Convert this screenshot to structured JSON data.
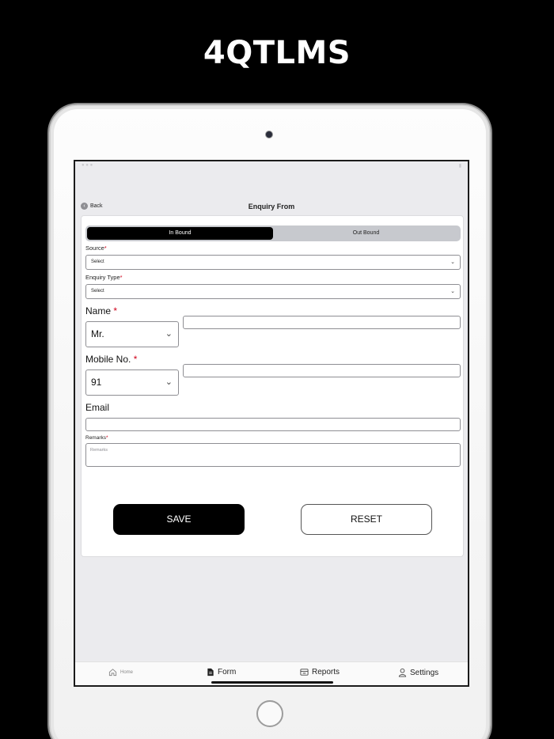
{
  "hero": {
    "title": "4QTLMS"
  },
  "nav": {
    "back_label": "Back",
    "title": "Enquiry From"
  },
  "segment": {
    "in_bound": "In Bound",
    "out_bound": "Out Bound"
  },
  "form": {
    "source": {
      "label": "Source",
      "required": "*",
      "value": "Select"
    },
    "enquiry_type": {
      "label": "Enquiry Type",
      "required": "*",
      "value": "Select"
    },
    "name": {
      "label": "Name",
      "required": "*",
      "title_value": "Mr.",
      "value": ""
    },
    "mobile": {
      "label": "Mobile No.",
      "required": "*",
      "code_value": "91",
      "value": ""
    },
    "email": {
      "label": "Email",
      "value": ""
    },
    "remarks": {
      "label": "Remarks",
      "required": "*",
      "placeholder": "Remarks"
    }
  },
  "buttons": {
    "save": "SAVE",
    "reset": "RESET"
  },
  "tabbar": {
    "home": "Home",
    "form": "Form",
    "reports": "Reports",
    "settings": "Settings"
  },
  "colors": {
    "accent": "#000000",
    "required": "#d0021b",
    "screen_bg": "#ebebee"
  }
}
